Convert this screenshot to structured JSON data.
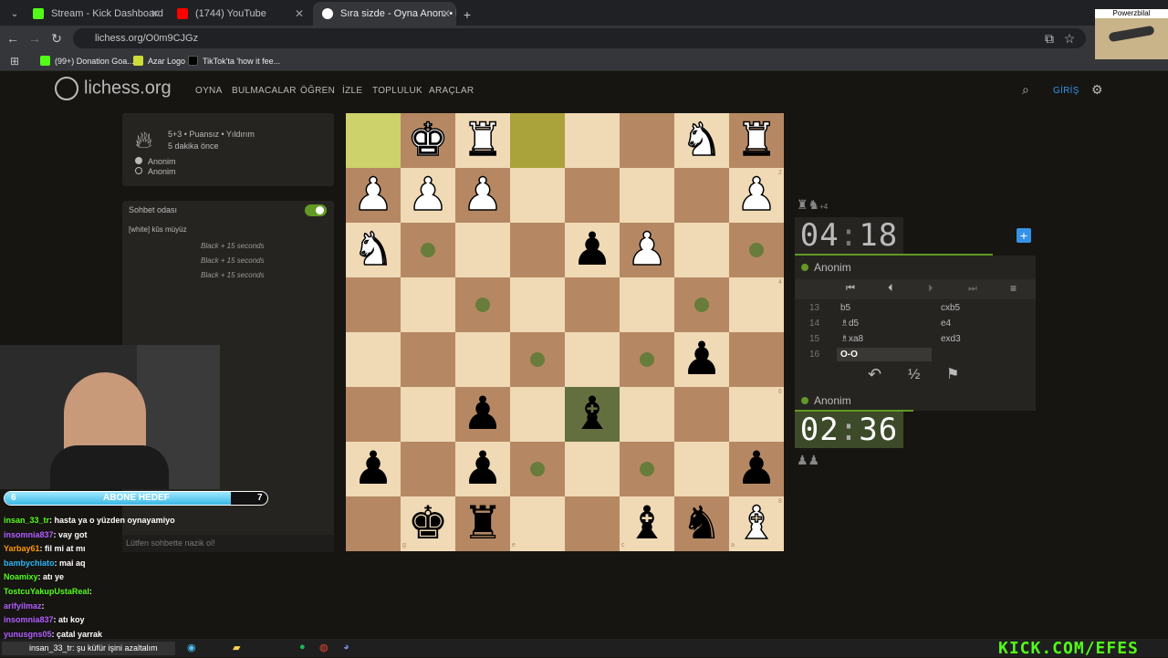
{
  "browser": {
    "tabs": [
      {
        "title": "Stream - Kick Dashboard",
        "color": "#53fc18"
      },
      {
        "title": "(1744) YouTube",
        "color": "#ff0000"
      },
      {
        "title": "Sıra sizde - Oyna Anon. • liches",
        "color": "#ffffff"
      }
    ],
    "url": "lichess.org/O0m9CJGz",
    "bookmarks": [
      {
        "label": "(99+) Donation Goa...",
        "color": "#53fc18"
      },
      {
        "label": "Azar Logo",
        "color": "#cddc39"
      },
      {
        "label": "TikTok'ta 'how it fee...",
        "color": "#000000"
      }
    ],
    "pip_label": "Powerzbilal"
  },
  "site": {
    "logo": "lichess.org",
    "nav": [
      "OYNA",
      "BULMACALAR",
      "ÖĞREN",
      "İZLE",
      "TOPLULUK",
      "ARAÇLAR"
    ],
    "login": "GİRİŞ"
  },
  "game": {
    "meta": "5+3 • Puansız • Yıldırım",
    "time": "5 dakika önce",
    "players": [
      "Anonim",
      "Anonim"
    ]
  },
  "chat": {
    "title": "Sohbet odası",
    "messages": [
      "[white] kûs müyüz"
    ],
    "system": [
      "Black + 15 seconds",
      "Black + 15 seconds",
      "Black + 15 seconds"
    ],
    "placeholder": "Lütfen sohbette nazik ol!"
  },
  "board": {
    "files": [
      "h",
      "g",
      "f",
      "e",
      "d",
      "c",
      "b",
      "a"
    ],
    "ranks": [
      "1",
      "2",
      "3",
      "4",
      "5",
      "6",
      "7",
      "8"
    ],
    "pieces": [
      {
        "sq": "g1",
        "p": "♚",
        "c": "w"
      },
      {
        "sq": "f1",
        "p": "♜",
        "c": "w"
      },
      {
        "sq": "b1",
        "p": "♞",
        "c": "w"
      },
      {
        "sq": "a1",
        "p": "♜",
        "c": "w"
      },
      {
        "sq": "h2",
        "p": "♟",
        "c": "w"
      },
      {
        "sq": "g2",
        "p": "♟",
        "c": "w"
      },
      {
        "sq": "f2",
        "p": "♟",
        "c": "w"
      },
      {
        "sq": "a2",
        "p": "♟",
        "c": "w"
      },
      {
        "sq": "h3",
        "p": "♞",
        "c": "w"
      },
      {
        "sq": "d3",
        "p": "♟",
        "c": "b"
      },
      {
        "sq": "c3",
        "p": "♟",
        "c": "w"
      },
      {
        "sq": "b5",
        "p": "♟",
        "c": "b"
      },
      {
        "sq": "f6",
        "p": "♟",
        "c": "b"
      },
      {
        "sq": "d6",
        "p": "♝",
        "c": "b"
      },
      {
        "sq": "h7",
        "p": "♟",
        "c": "b"
      },
      {
        "sq": "f7",
        "p": "♟",
        "c": "b"
      },
      {
        "sq": "a7",
        "p": "♟",
        "c": "b"
      },
      {
        "sq": "g8",
        "p": "♚",
        "c": "b"
      },
      {
        "sq": "f8",
        "p": "♜",
        "c": "b"
      },
      {
        "sq": "c8",
        "p": "♝",
        "c": "b"
      },
      {
        "sq": "b8",
        "p": "♞",
        "c": "b"
      },
      {
        "sq": "a8",
        "p": "♝",
        "c": "w"
      }
    ],
    "dots": [
      "g3",
      "a3",
      "f4",
      "b4",
      "e5",
      "c5",
      "e7",
      "c7"
    ]
  },
  "clocks": {
    "top_min": "04",
    "top_sec": "18",
    "bot_min": "02",
    "bot_sec": "36",
    "top_material": "+4"
  },
  "moves": [
    {
      "n": "13",
      "w": "b5",
      "b": "cxb5"
    },
    {
      "n": "14",
      "w": "♗d5",
      "b": "e4"
    },
    {
      "n": "15",
      "w": "♗xa8",
      "b": "exd3"
    },
    {
      "n": "16",
      "w": "O-O",
      "b": ""
    }
  ],
  "stream": {
    "goal_label": "ABONE HEDEF",
    "goal_current": "6",
    "goal_target": "7",
    "goal_fraction": 0.86,
    "chat": [
      {
        "user": "insan_33_tr",
        "msg": ": hasta ya o yüzden oynayamiyo",
        "color": "#53fc18"
      },
      {
        "user": "insomnia837",
        "msg": ": vay got",
        "color": "#b05cff"
      },
      {
        "user": "Yarbay61",
        "msg": ": fil mi at mı",
        "color": "#ff9800"
      },
      {
        "user": "bambychiato",
        "msg": ": mai aq",
        "color": "#29b6f6"
      },
      {
        "user": "Noamixy",
        "msg": ": atı ye",
        "color": "#53fc18"
      },
      {
        "user": "TostcuYakupUstaReal",
        "msg": ":",
        "color": "#53fc18"
      },
      {
        "user": "arifyilmaz",
        "msg": ":",
        "color": "#b05cff"
      },
      {
        "user": "insomnia837",
        "msg": ": atı koy",
        "color": "#b05cff"
      },
      {
        "user": "yunusgns05",
        "msg": ": çatal yarrak",
        "color": "#b05cff"
      }
    ],
    "ticker": "insan_33_tr: şu küfür işini azaltalım",
    "kick_brand": "KICK.COM/EFES"
  }
}
